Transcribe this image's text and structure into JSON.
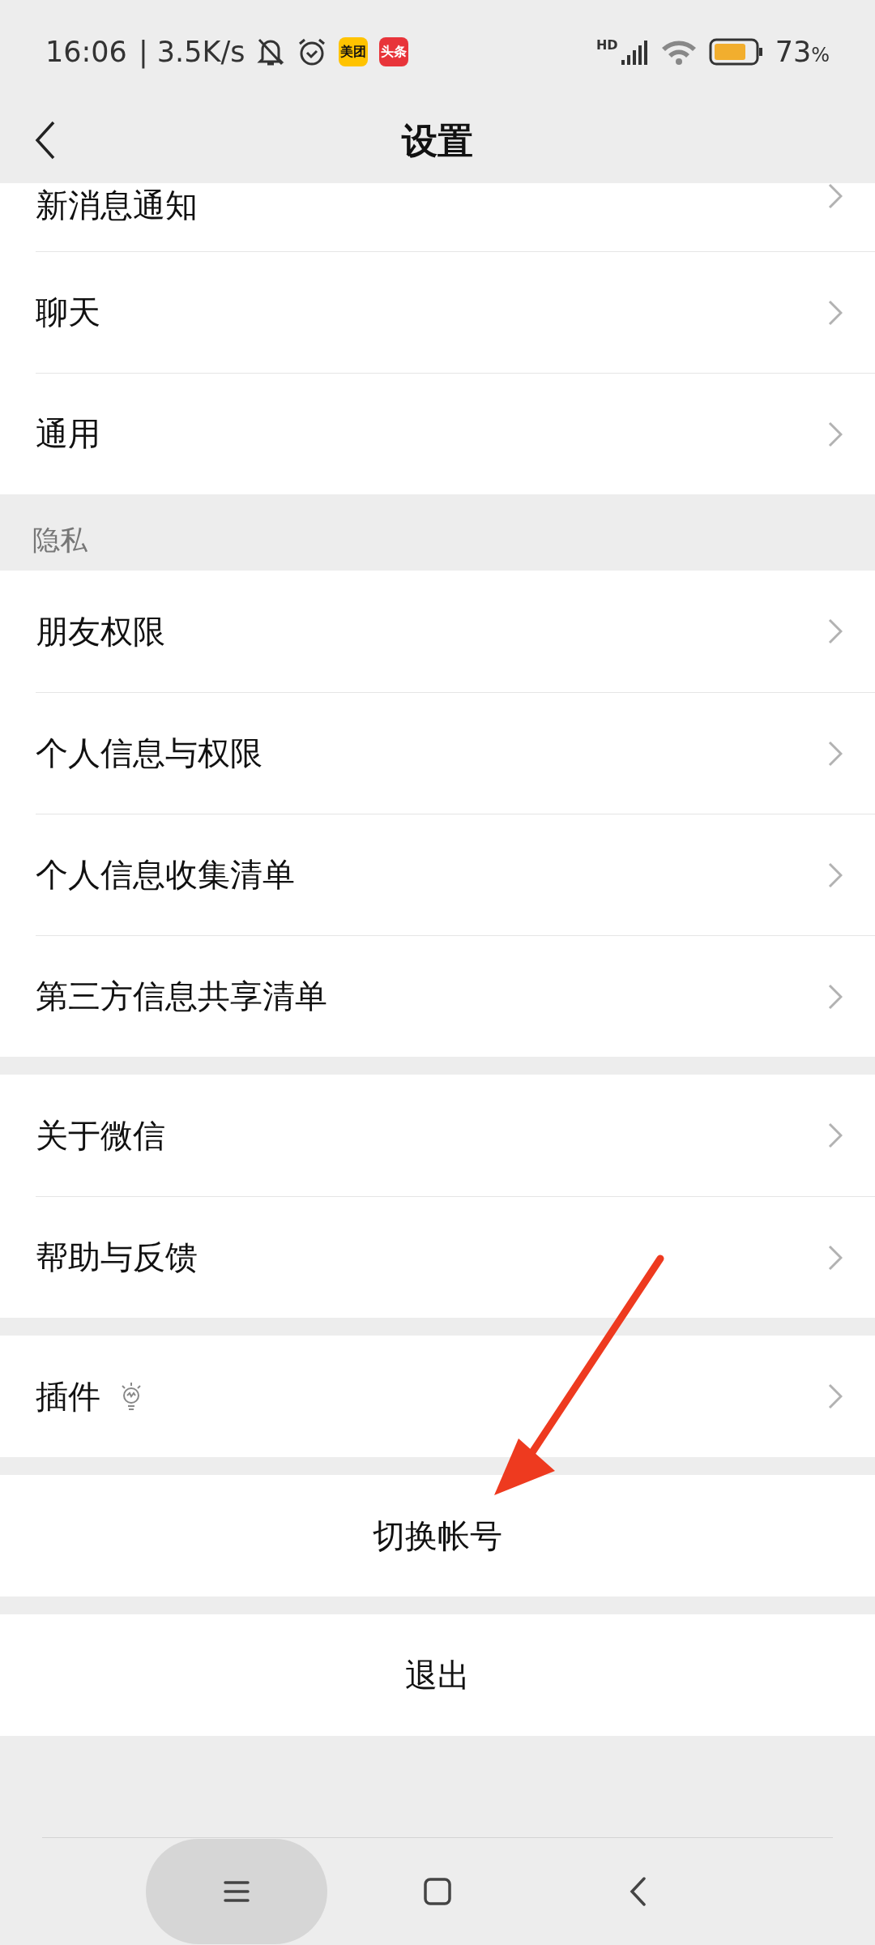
{
  "status_bar": {
    "time": "16:06",
    "speed": "| 3.5K/s",
    "app_badges": [
      {
        "label": "美团",
        "color": "#ffc300"
      },
      {
        "label": "头条",
        "color": "#e8343a"
      }
    ],
    "network": "HD",
    "battery": "73",
    "battery_unit": "%"
  },
  "header": {
    "title": "设置"
  },
  "sections": [
    {
      "rows": [
        {
          "label": "新消息通知",
          "kind": "nav"
        },
        {
          "label": "聊天",
          "kind": "nav"
        },
        {
          "label": "通用",
          "kind": "nav"
        }
      ]
    },
    {
      "header": "隐私",
      "rows": [
        {
          "label": "朋友权限",
          "kind": "nav"
        },
        {
          "label": "个人信息与权限",
          "kind": "nav"
        },
        {
          "label": "个人信息收集清单",
          "kind": "nav"
        },
        {
          "label": "第三方信息共享清单",
          "kind": "nav"
        }
      ]
    },
    {
      "rows": [
        {
          "label": "关于微信",
          "kind": "nav"
        },
        {
          "label": "帮助与反馈",
          "kind": "nav"
        }
      ]
    },
    {
      "rows": [
        {
          "label": "插件",
          "kind": "nav",
          "hint_icon": true
        }
      ]
    },
    {
      "rows": [
        {
          "label": "切换帐号",
          "kind": "action"
        }
      ]
    },
    {
      "rows": [
        {
          "label": "退出",
          "kind": "action"
        }
      ]
    }
  ],
  "nav_bar": {
    "recents_pressed": true
  }
}
